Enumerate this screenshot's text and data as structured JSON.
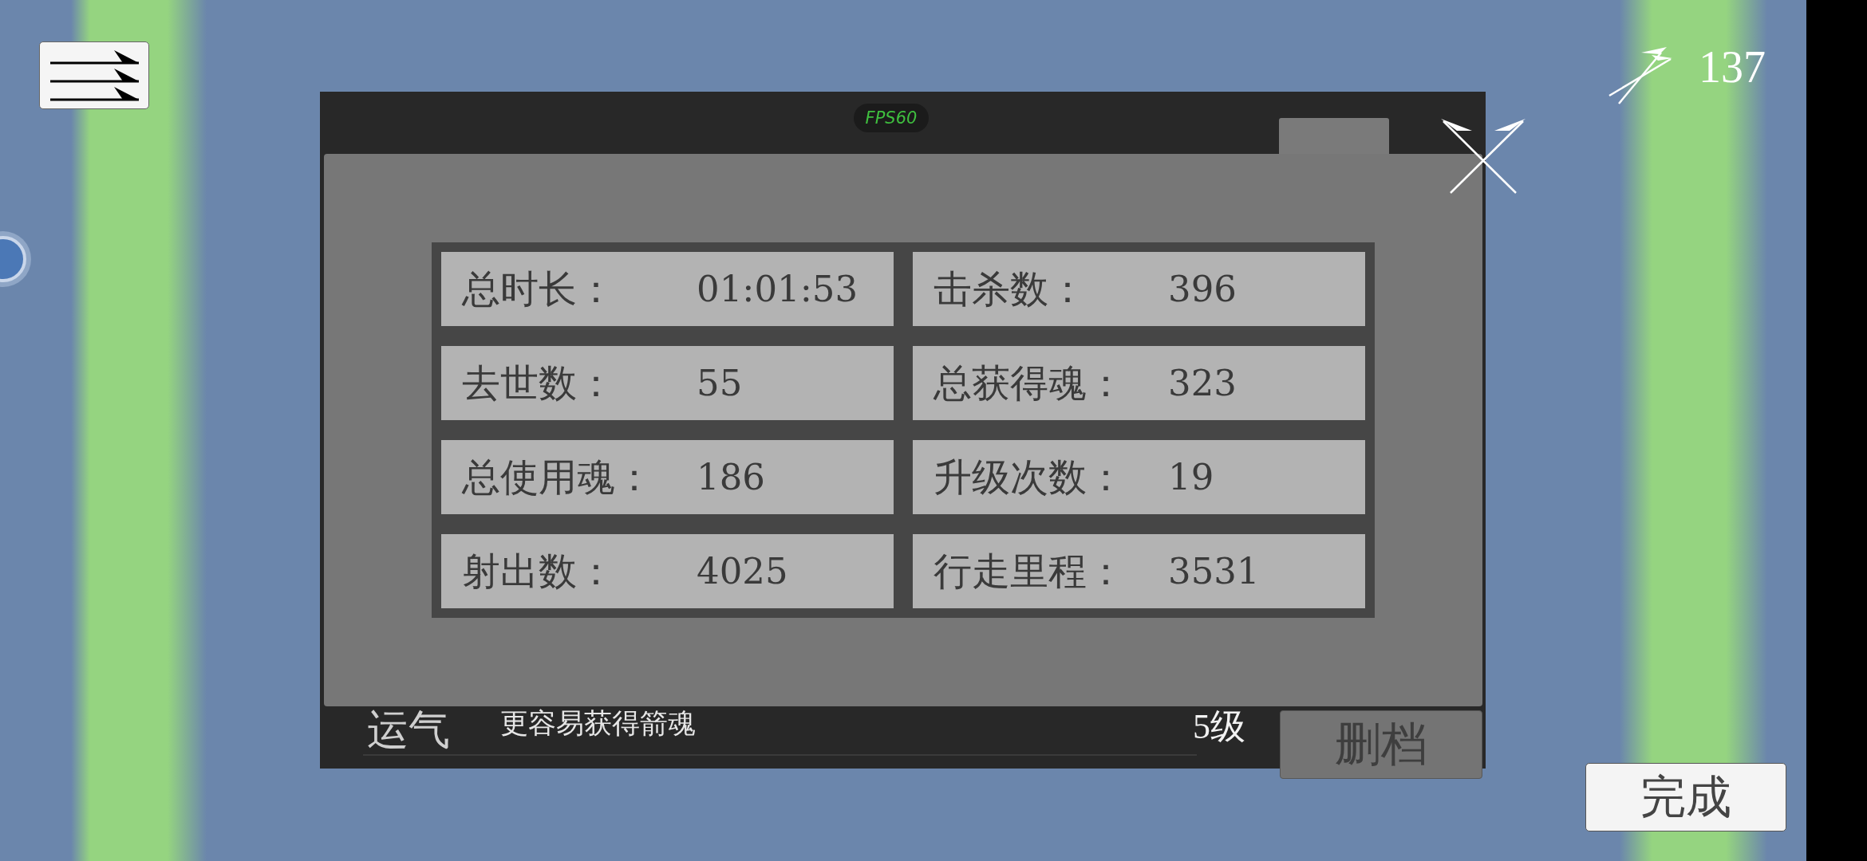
{
  "hud": {
    "arrow_count": "137"
  },
  "upgrade_panel": {
    "rows": [
      {
        "name": "运气",
        "description": "更容易获得箭魂",
        "tier": "5级"
      }
    ]
  },
  "fps_badge": "FPS60",
  "stats_dialog": {
    "stats": [
      {
        "label": "总时长：",
        "value": "01:01:53"
      },
      {
        "label": "击杀数：",
        "value": "396"
      },
      {
        "label": "去世数：",
        "value": "55"
      },
      {
        "label": "总获得魂：",
        "value": "323"
      },
      {
        "label": "总使用魂：",
        "value": "186"
      },
      {
        "label": "升级次数：",
        "value": "19"
      },
      {
        "label": "射出数：",
        "value": "4025"
      },
      {
        "label": "行走里程：",
        "value": "3531"
      }
    ]
  },
  "delete_save_button": "删档",
  "done_button": "完成"
}
